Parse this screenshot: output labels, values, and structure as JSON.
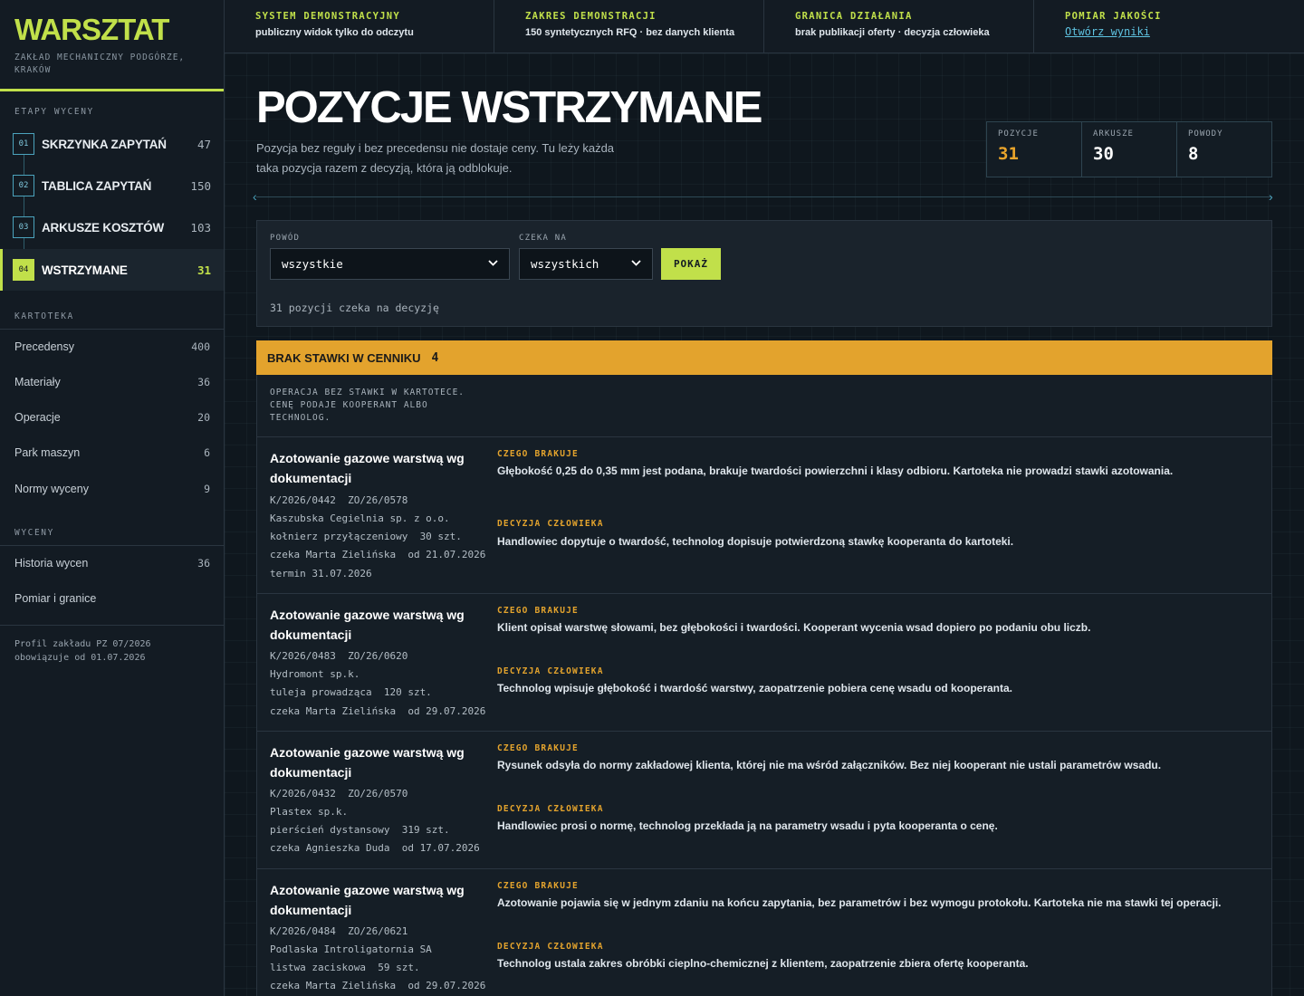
{
  "brand": {
    "title": "WARSZTAT",
    "subtitle": "ZAKŁAD MECHANICZNY PODGÓRZE, KRAKÓW"
  },
  "sidebar": {
    "stages_label": "ETAPY WYCENY",
    "stages": [
      {
        "num": "01",
        "label": "SKRZYNKA ZAPYTAŃ",
        "count": "47"
      },
      {
        "num": "02",
        "label": "TABLICA ZAPYTAŃ",
        "count": "150"
      },
      {
        "num": "03",
        "label": "ARKUSZE KOSZTÓW",
        "count": "103"
      },
      {
        "num": "04",
        "label": "WSTRZYMANE",
        "count": "31"
      }
    ],
    "catalog_label": "KARTOTEKA",
    "catalog": [
      {
        "label": "Precedensy",
        "count": "400"
      },
      {
        "label": "Materiały",
        "count": "36"
      },
      {
        "label": "Operacje",
        "count": "20"
      },
      {
        "label": "Park maszyn",
        "count": "6"
      },
      {
        "label": "Normy wyceny",
        "count": "9"
      }
    ],
    "quotes_label": "WYCENY",
    "quotes": [
      {
        "label": "Historia wycen",
        "count": "36"
      },
      {
        "label": "Pomiar i granice",
        "count": ""
      }
    ],
    "profile_line1": "Profil zakładu PZ 07/2026",
    "profile_line2": "obowiązuje od 01.07.2026"
  },
  "topbar": [
    {
      "title": "SYSTEM DEMONSTRACYJNY",
      "value": "publiczny widok tylko do odczytu"
    },
    {
      "title": "ZAKRES DEMONSTRACJI",
      "value": "150 syntetycznych RFQ · bez danych klienta"
    },
    {
      "title": "GRANICA DZIAŁANIA",
      "value": "brak publikacji oferty · decyzja człowieka"
    },
    {
      "title": "POMIAR JAKOŚCI",
      "link": "Otwórz wyniki"
    }
  ],
  "page": {
    "title": "POZYCJE WSTRZYMANE",
    "description": "Pozycja bez reguły i bez precedensu nie dostaje ceny. Tu leży każda taka pozycja razem z decyzją, która ją odblokuje."
  },
  "stats": [
    {
      "label": "POZYCJE",
      "value": "31"
    },
    {
      "label": "ARKUSZE",
      "value": "30"
    },
    {
      "label": "POWODY",
      "value": "8"
    }
  ],
  "filter": {
    "reason_label": "POWÓD",
    "reason_value": "wszystkie",
    "waiting_label": "CZEKA NA",
    "waiting_value": "wszystkich",
    "button": "POKAŻ",
    "status": "31 pozycji czeka na decyzję"
  },
  "group": {
    "title": "BRAK STAWKI W CENNIKU",
    "count": "4",
    "note": "OPERACJA BEZ STAWKI W KARTOTECE. CENĘ PODAJE KOOPERANT ALBO TECHNOLOG.",
    "missing_label": "CZEGO BRAKUJE",
    "decision_label": "DECYZJA CZŁOWIEKA",
    "items": [
      {
        "title": "Azotowanie gazowe warstwą wg dokumentacji",
        "ids": "K/2026/0442  ZO/26/0578",
        "client": "Kaszubska Cegielnia sp. z o.o.",
        "part": "kołnierz przyłączeniowy  30 szt.",
        "waiting": "czeka Marta Zielińska  od 21.07.2026",
        "deadline": "termin 31.07.2026",
        "missing": "Głębokość 0,25 do 0,35 mm jest podana, brakuje twardości powierzchni i klasy odbioru. Kartoteka nie prowadzi stawki azotowania.",
        "decision": "Handlowiec dopytuje o twardość, technolog dopisuje potwierdzoną stawkę kooperanta do kartoteki."
      },
      {
        "title": "Azotowanie gazowe warstwą wg dokumentacji",
        "ids": "K/2026/0483  ZO/26/0620",
        "client": "Hydromont sp.k.",
        "part": "tuleja prowadząca  120 szt.",
        "waiting": "czeka Marta Zielińska  od 29.07.2026",
        "deadline": "",
        "missing": "Klient opisał warstwę słowami, bez głębokości i twardości. Kooperant wycenia wsad dopiero po podaniu obu liczb.",
        "decision": "Technolog wpisuje głębokość i twardość warstwy, zaopatrzenie pobiera cenę wsadu od kooperanta."
      },
      {
        "title": "Azotowanie gazowe warstwą wg dokumentacji",
        "ids": "K/2026/0432  ZO/26/0570",
        "client": "Plastex sp.k.",
        "part": "pierścień dystansowy  319 szt.",
        "waiting": "czeka Agnieszka Duda  od 17.07.2026",
        "deadline": "",
        "missing": "Rysunek odsyła do normy zakładowej klienta, której nie ma wśród załączników. Bez niej kooperant nie ustali parametrów wsadu.",
        "decision": "Handlowiec prosi o normę, technolog przekłada ją na parametry wsadu i pyta kooperanta o cenę."
      },
      {
        "title": "Azotowanie gazowe warstwą wg dokumentacji",
        "ids": "K/2026/0484  ZO/26/0621",
        "client": "Podlaska Introligatornia SA",
        "part": "listwa zaciskowa  59 szt.",
        "waiting": "czeka Marta Zielińska  od 29.07.2026",
        "deadline": "",
        "missing": "Azotowanie pojawia się w jednym zdaniu na końcu zapytania, bez parametrów i bez wymogu protokołu. Kartoteka nie ma stawki tej operacji.",
        "decision": "Technolog ustala zakres obróbki cieplno-chemicznej z klientem, zaopatrzenie zbiera ofertę kooperanta."
      }
    ]
  },
  "colors": {
    "accent": "#c1e04a",
    "warning": "#e3a32d",
    "link": "#5ec2e0",
    "background": "#0f171e"
  }
}
